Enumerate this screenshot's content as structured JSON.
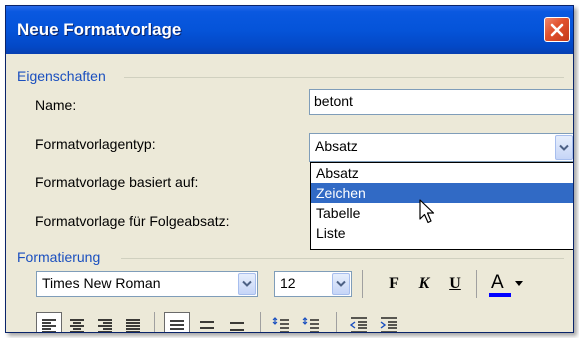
{
  "dialog": {
    "title": "Neue Formatvorlage",
    "close_icon": "close-icon",
    "title_gradient": "#0554D9",
    "face_color": "#ECE9D8"
  },
  "properties": {
    "group_label": "Eigenschaften",
    "name_label": "Name:",
    "name_value": "betont",
    "type_label": "Formatvorlagentyp:",
    "type_value": "Absatz",
    "based_on_label": "Formatvorlage basiert auf:",
    "following_label": "Formatvorlage für Folgeabsatz:"
  },
  "type_dropdown": {
    "options": [
      "Absatz",
      "Zeichen",
      "Tabelle",
      "Liste"
    ],
    "highlighted": "Zeichen",
    "highlight_color": "#316AC5"
  },
  "formatting": {
    "group_label": "Formatierung",
    "font_value": "Times New Roman",
    "size_value": "12",
    "bold_label": "F",
    "italic_label": "K",
    "underline_label": "U",
    "font_color_label": "A",
    "font_color": "#0000FF"
  }
}
